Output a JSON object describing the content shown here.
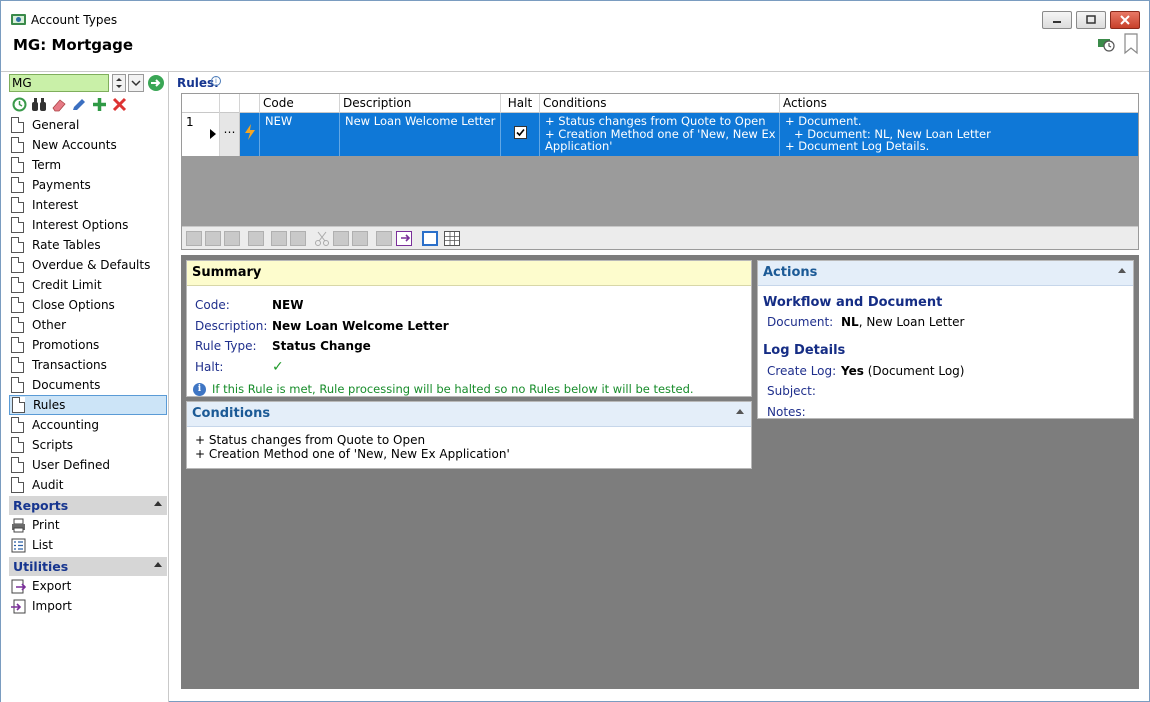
{
  "window": {
    "title": "Account Types"
  },
  "header": {
    "title": "MG: Mortgage"
  },
  "sidebar": {
    "code_value": "MG",
    "items": [
      {
        "label": "General"
      },
      {
        "label": "New Accounts"
      },
      {
        "label": "Term"
      },
      {
        "label": "Payments"
      },
      {
        "label": "Interest"
      },
      {
        "label": "Interest Options"
      },
      {
        "label": "Rate Tables"
      },
      {
        "label": "Overdue & Defaults"
      },
      {
        "label": "Credit Limit"
      },
      {
        "label": "Close Options"
      },
      {
        "label": "Other"
      },
      {
        "label": "Promotions"
      },
      {
        "label": "Transactions"
      },
      {
        "label": "Documents"
      },
      {
        "label": "Rules"
      },
      {
        "label": "Accounting"
      },
      {
        "label": "Scripts"
      },
      {
        "label": "User Defined"
      },
      {
        "label": "Audit"
      }
    ],
    "active_item": "Rules",
    "reports": {
      "title": "Reports",
      "items": [
        {
          "label": "Print"
        },
        {
          "label": "List"
        }
      ]
    },
    "utilities": {
      "title": "Utilities",
      "items": [
        {
          "label": "Export"
        },
        {
          "label": "Import"
        }
      ]
    }
  },
  "rules": {
    "label": "Rules.",
    "columns": {
      "code": "Code",
      "description": "Description",
      "halt": "Halt",
      "conditions": "Conditions",
      "actions": "Actions"
    },
    "rows": [
      {
        "num": "1",
        "code": "NEW",
        "description": "New Loan Welcome Letter",
        "halt": true,
        "conditions": [
          "+ Status changes from Quote to Open",
          "+ Creation Method one of 'New, New Ex",
          "Application'"
        ],
        "actions": [
          "+ Document.",
          "   + Document: NL, New Loan Letter",
          "+ Document Log Details."
        ]
      }
    ]
  },
  "summary": {
    "title": "Summary",
    "code_label": "Code:",
    "code_value": "NEW",
    "description_label": "Description:",
    "description_value": "New Loan Welcome Letter",
    "rule_type_label": "Rule Type:",
    "rule_type_value": "Status Change",
    "halt_label": "Halt:",
    "halt_value": "✓",
    "halt_note": "If this Rule is met, Rule processing will be halted so no Rules below it will be tested."
  },
  "conditions_panel": {
    "title": "Conditions",
    "lines": [
      "+ Status changes from Quote to Open",
      "+ Creation Method one of 'New, New Ex Application'"
    ]
  },
  "actions_panel": {
    "title": "Actions",
    "workflow_title": "Workflow and Document",
    "document_label": "Document:",
    "document_code": "NL",
    "document_name": ", New Loan Letter",
    "log_title": "Log Details",
    "create_log_label": "Create Log:",
    "create_log_value": "Yes",
    "create_log_extra": " (Document Log)",
    "subject_label": "Subject:",
    "notes_label": "Notes:"
  },
  "colors": {
    "selection": "#0f78d7",
    "nav_active": "#cce4f7",
    "summary_header": "#fdfccd",
    "section_header": "#e4eef9",
    "accent_text": "#16358f",
    "halt_note": "#178c2a"
  }
}
